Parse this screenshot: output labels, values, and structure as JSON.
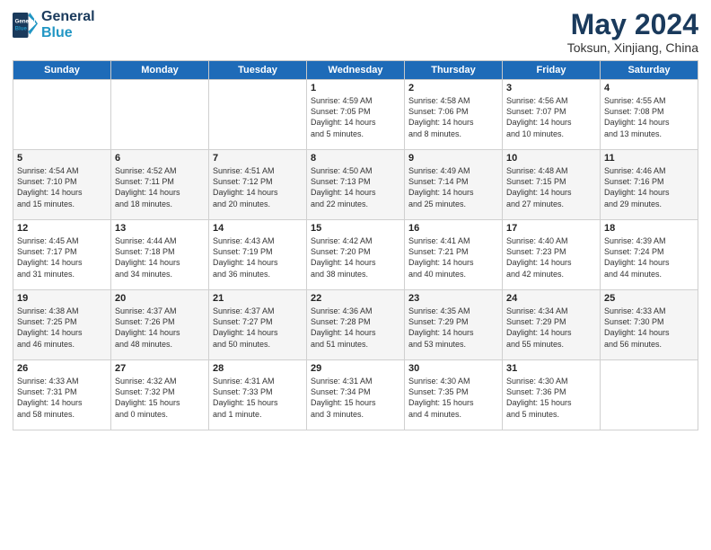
{
  "header": {
    "logo_line1": "General",
    "logo_line2": "Blue",
    "title": "May 2024",
    "subtitle": "Toksun, Xinjiang, China"
  },
  "days_of_week": [
    "Sunday",
    "Monday",
    "Tuesday",
    "Wednesday",
    "Thursday",
    "Friday",
    "Saturday"
  ],
  "weeks": [
    [
      {
        "day": "",
        "content": ""
      },
      {
        "day": "",
        "content": ""
      },
      {
        "day": "",
        "content": ""
      },
      {
        "day": "1",
        "content": "Sunrise: 4:59 AM\nSunset: 7:05 PM\nDaylight: 14 hours\nand 5 minutes."
      },
      {
        "day": "2",
        "content": "Sunrise: 4:58 AM\nSunset: 7:06 PM\nDaylight: 14 hours\nand 8 minutes."
      },
      {
        "day": "3",
        "content": "Sunrise: 4:56 AM\nSunset: 7:07 PM\nDaylight: 14 hours\nand 10 minutes."
      },
      {
        "day": "4",
        "content": "Sunrise: 4:55 AM\nSunset: 7:08 PM\nDaylight: 14 hours\nand 13 minutes."
      }
    ],
    [
      {
        "day": "5",
        "content": "Sunrise: 4:54 AM\nSunset: 7:10 PM\nDaylight: 14 hours\nand 15 minutes."
      },
      {
        "day": "6",
        "content": "Sunrise: 4:52 AM\nSunset: 7:11 PM\nDaylight: 14 hours\nand 18 minutes."
      },
      {
        "day": "7",
        "content": "Sunrise: 4:51 AM\nSunset: 7:12 PM\nDaylight: 14 hours\nand 20 minutes."
      },
      {
        "day": "8",
        "content": "Sunrise: 4:50 AM\nSunset: 7:13 PM\nDaylight: 14 hours\nand 22 minutes."
      },
      {
        "day": "9",
        "content": "Sunrise: 4:49 AM\nSunset: 7:14 PM\nDaylight: 14 hours\nand 25 minutes."
      },
      {
        "day": "10",
        "content": "Sunrise: 4:48 AM\nSunset: 7:15 PM\nDaylight: 14 hours\nand 27 minutes."
      },
      {
        "day": "11",
        "content": "Sunrise: 4:46 AM\nSunset: 7:16 PM\nDaylight: 14 hours\nand 29 minutes."
      }
    ],
    [
      {
        "day": "12",
        "content": "Sunrise: 4:45 AM\nSunset: 7:17 PM\nDaylight: 14 hours\nand 31 minutes."
      },
      {
        "day": "13",
        "content": "Sunrise: 4:44 AM\nSunset: 7:18 PM\nDaylight: 14 hours\nand 34 minutes."
      },
      {
        "day": "14",
        "content": "Sunrise: 4:43 AM\nSunset: 7:19 PM\nDaylight: 14 hours\nand 36 minutes."
      },
      {
        "day": "15",
        "content": "Sunrise: 4:42 AM\nSunset: 7:20 PM\nDaylight: 14 hours\nand 38 minutes."
      },
      {
        "day": "16",
        "content": "Sunrise: 4:41 AM\nSunset: 7:21 PM\nDaylight: 14 hours\nand 40 minutes."
      },
      {
        "day": "17",
        "content": "Sunrise: 4:40 AM\nSunset: 7:23 PM\nDaylight: 14 hours\nand 42 minutes."
      },
      {
        "day": "18",
        "content": "Sunrise: 4:39 AM\nSunset: 7:24 PM\nDaylight: 14 hours\nand 44 minutes."
      }
    ],
    [
      {
        "day": "19",
        "content": "Sunrise: 4:38 AM\nSunset: 7:25 PM\nDaylight: 14 hours\nand 46 minutes."
      },
      {
        "day": "20",
        "content": "Sunrise: 4:37 AM\nSunset: 7:26 PM\nDaylight: 14 hours\nand 48 minutes."
      },
      {
        "day": "21",
        "content": "Sunrise: 4:37 AM\nSunset: 7:27 PM\nDaylight: 14 hours\nand 50 minutes."
      },
      {
        "day": "22",
        "content": "Sunrise: 4:36 AM\nSunset: 7:28 PM\nDaylight: 14 hours\nand 51 minutes."
      },
      {
        "day": "23",
        "content": "Sunrise: 4:35 AM\nSunset: 7:29 PM\nDaylight: 14 hours\nand 53 minutes."
      },
      {
        "day": "24",
        "content": "Sunrise: 4:34 AM\nSunset: 7:29 PM\nDaylight: 14 hours\nand 55 minutes."
      },
      {
        "day": "25",
        "content": "Sunrise: 4:33 AM\nSunset: 7:30 PM\nDaylight: 14 hours\nand 56 minutes."
      }
    ],
    [
      {
        "day": "26",
        "content": "Sunrise: 4:33 AM\nSunset: 7:31 PM\nDaylight: 14 hours\nand 58 minutes."
      },
      {
        "day": "27",
        "content": "Sunrise: 4:32 AM\nSunset: 7:32 PM\nDaylight: 15 hours\nand 0 minutes."
      },
      {
        "day": "28",
        "content": "Sunrise: 4:31 AM\nSunset: 7:33 PM\nDaylight: 15 hours\nand 1 minute."
      },
      {
        "day": "29",
        "content": "Sunrise: 4:31 AM\nSunset: 7:34 PM\nDaylight: 15 hours\nand 3 minutes."
      },
      {
        "day": "30",
        "content": "Sunrise: 4:30 AM\nSunset: 7:35 PM\nDaylight: 15 hours\nand 4 minutes."
      },
      {
        "day": "31",
        "content": "Sunrise: 4:30 AM\nSunset: 7:36 PM\nDaylight: 15 hours\nand 5 minutes."
      },
      {
        "day": "",
        "content": ""
      }
    ]
  ]
}
